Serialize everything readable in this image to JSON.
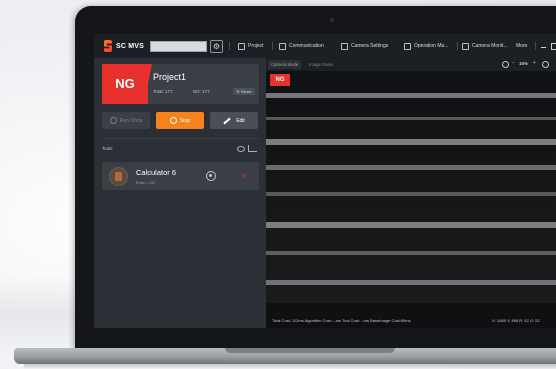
{
  "app": {
    "name": "SC MVS"
  },
  "menu": [
    {
      "label": "Project",
      "icon": "grid-icon"
    },
    {
      "label": "Communication",
      "icon": "monitor-icon"
    },
    {
      "label": "Camera Settings",
      "icon": "camera-icon"
    },
    {
      "label": "Operation Ma...",
      "icon": "list-icon"
    },
    {
      "label": "Camera Monit...",
      "icon": "screen-icon"
    },
    {
      "label": "More",
      "icon": "chevron-down-icon"
    }
  ],
  "project": {
    "status": "NG",
    "title": "Project1",
    "total": "Total: 177",
    "ng": "NG: 177",
    "reset_label": "Reset"
  },
  "actions": {
    "run_label": "Run Once",
    "stop_label": "Stop",
    "edit_label": "Edit"
  },
  "tools": {
    "label": "Tools",
    "items": [
      {
        "name": "Calculator 6",
        "status": "Exist = OK"
      }
    ]
  },
  "view": {
    "tabs": [
      "Camera Mode",
      "Image Mode"
    ],
    "active_tab": "Camera Mode",
    "zoom": "16%",
    "zoom_minus": "−",
    "zoom_plus": "+",
    "result_badge": "NG",
    "status": "Total Cost: 112ms   Algorithm Cost: --ms   Tool Cost: --ms   BaseImage Cost:89ms",
    "coords": "X: 1085 Y: 898   R: 52 G: 52"
  },
  "colors": {
    "accent_orange": "#f7831d",
    "ng_red": "#e8312c",
    "panel": "#2c3036"
  }
}
